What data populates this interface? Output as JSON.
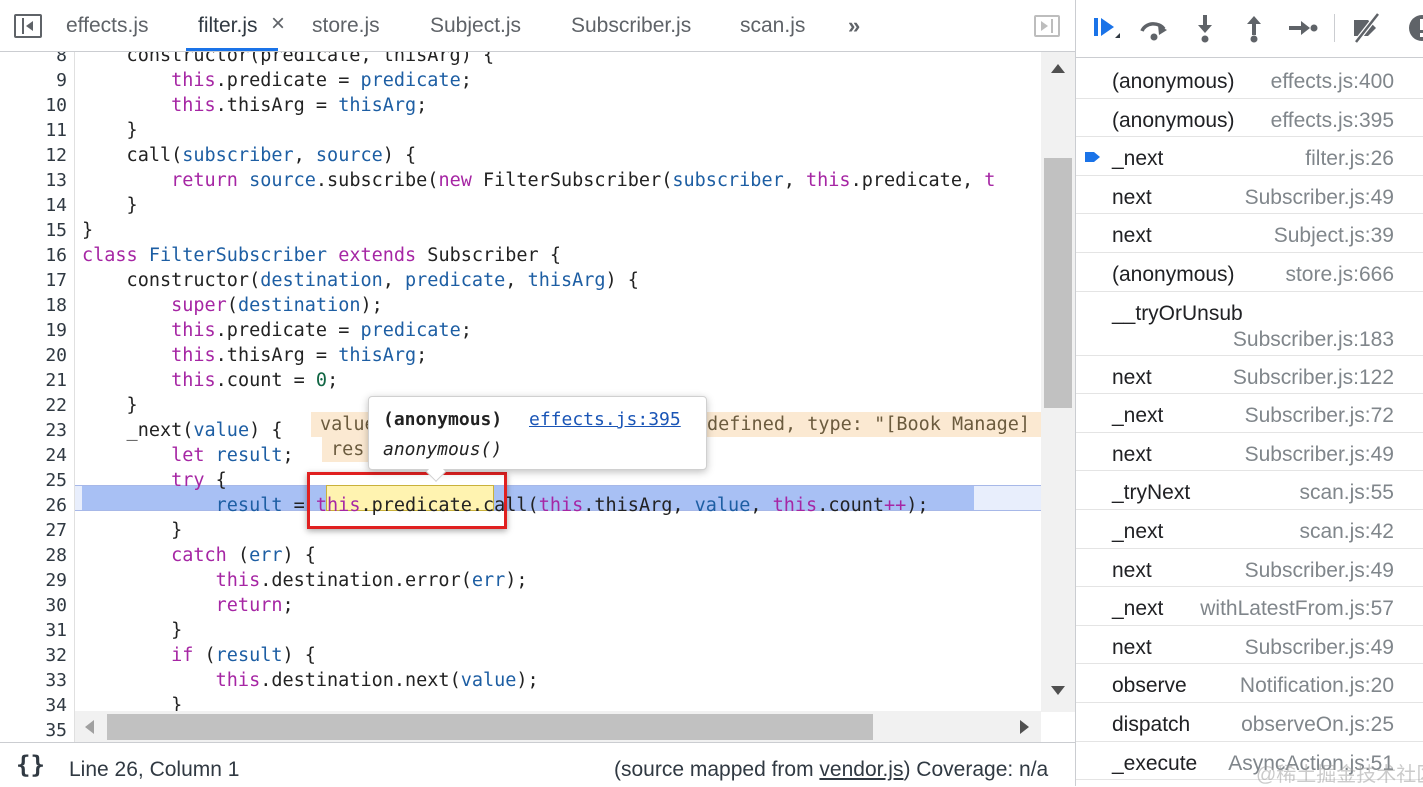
{
  "tabs": [
    {
      "label": "effects.js",
      "active": false
    },
    {
      "label": "filter.js",
      "active": true,
      "close": "×"
    },
    {
      "label": "store.js",
      "active": false
    },
    {
      "label": "Subject.js",
      "active": false
    },
    {
      "label": "Subscriber.js",
      "active": false
    },
    {
      "label": "scan.js",
      "active": false
    }
  ],
  "tab_more": "»",
  "editor": {
    "lines": [
      {
        "n": "8",
        "html": "    constructor(predicate, thisArg) {"
      },
      {
        "n": "9",
        "html": "        <span class=\"kw\">this</span>.predicate = <span class=\"prm\">predicate</span>;"
      },
      {
        "n": "10",
        "html": "        <span class=\"kw\">this</span>.thisArg = <span class=\"prm\">thisArg</span>;"
      },
      {
        "n": "11",
        "html": "    }"
      },
      {
        "n": "12",
        "html": "    call(<span class=\"prm\">subscriber</span>, <span class=\"prm\">source</span>) {"
      },
      {
        "n": "13",
        "html": "        <span class=\"kw\">return</span> <span class=\"prm\">source</span>.subscribe(<span class=\"kw\">new</span> FilterSubscriber(<span class=\"prm\">subscriber</span>, <span class=\"kw\">this</span>.predicate, <span class=\"kw\">t</span>"
      },
      {
        "n": "14",
        "html": "    }"
      },
      {
        "n": "15",
        "html": "}"
      },
      {
        "n": "16",
        "html": "<span class=\"kw\">class</span> <span class=\"prm\">FilterSubscriber</span> <span class=\"kw\">extends</span> Subscriber {"
      },
      {
        "n": "17",
        "html": "    constructor(<span class=\"prm\">destination</span>, <span class=\"prm\">predicate</span>, <span class=\"prm\">thisArg</span>) {"
      },
      {
        "n": "18",
        "html": "        <span class=\"kw\">super</span>(<span class=\"prm\">destination</span>);"
      },
      {
        "n": "19",
        "html": "        <span class=\"kw\">this</span>.predicate = <span class=\"prm\">predicate</span>;"
      },
      {
        "n": "20",
        "html": "        <span class=\"kw\">this</span>.thisArg = <span class=\"prm\">thisArg</span>;"
      },
      {
        "n": "21",
        "html": "        <span class=\"kw\">this</span>.count = <span class=\"num\">0</span>;"
      },
      {
        "n": "22",
        "html": "    }"
      },
      {
        "n": "23",
        "html": "    _next(<span class=\"prm\">value</span>) {"
      },
      {
        "n": "24",
        "html": "        <span class=\"kw\">let</span> <span class=\"prm\">result</span>;"
      },
      {
        "n": "25",
        "html": "        <span class=\"kw\">try</span> {"
      },
      {
        "n": "26",
        "html": "            <span class=\"prm\">result</span> = <span class=\"kw\">this</span>.predicate.call(<span class=\"kw\">this</span>.thisArg, <span class=\"prm\">value</span>, <span class=\"kw\">this</span>.count<span class=\"kw\">++</span>);"
      },
      {
        "n": "27",
        "html": "        }"
      },
      {
        "n": "28",
        "html": "        <span class=\"kw\">catch</span> (<span class=\"prm\">err</span>) {"
      },
      {
        "n": "29",
        "html": "            <span class=\"kw\">this</span>.destination.error(<span class=\"prm\">err</span>);"
      },
      {
        "n": "30",
        "html": "            <span class=\"kw\">return</span>;"
      },
      {
        "n": "31",
        "html": "        }"
      },
      {
        "n": "32",
        "html": "        <span class=\"kw\">if</span> (<span class=\"prm\">result</span>) {"
      },
      {
        "n": "33",
        "html": "            <span class=\"kw\">this</span>.destination.next(<span class=\"prm\">value</span>);"
      },
      {
        "n": "34",
        "html": "        }"
      },
      {
        "n": "35",
        "html": ""
      }
    ],
    "inline_value_line23": "value",
    "inline_value_line23_tail": "defined, type: \"[Book Manage]",
    "inline_value_line24": "res",
    "highlight_text": "this.predicate",
    "popover": {
      "name": "(anonymous)",
      "link": "effects.js:395",
      "signature": "anonymous()"
    }
  },
  "status": {
    "braces": "{}",
    "position": "Line 26, Column 1",
    "source_prefix": "(source mapped from ",
    "source_file": "vendor.js",
    "source_suffix": ")  Coverage: n/a"
  },
  "call_stack": [
    {
      "name": "(anonymous)",
      "loc": "effects.js:400"
    },
    {
      "name": "(anonymous)",
      "loc": "effects.js:395"
    },
    {
      "name": "_next",
      "loc": "filter.js:26",
      "current": true
    },
    {
      "name": "next",
      "loc": "Subscriber.js:49"
    },
    {
      "name": "next",
      "loc": "Subject.js:39"
    },
    {
      "name": "(anonymous)",
      "loc": "store.js:666"
    },
    {
      "name": "__tryOrUnsub",
      "loc": "Subscriber.js:183",
      "two_line": true
    },
    {
      "name": "next",
      "loc": "Subscriber.js:122"
    },
    {
      "name": "_next",
      "loc": "Subscriber.js:72"
    },
    {
      "name": "next",
      "loc": "Subscriber.js:49"
    },
    {
      "name": "_tryNext",
      "loc": "scan.js:55"
    },
    {
      "name": "_next",
      "loc": "scan.js:42"
    },
    {
      "name": "next",
      "loc": "Subscriber.js:49"
    },
    {
      "name": "_next",
      "loc": "withLatestFrom.js:57"
    },
    {
      "name": "next",
      "loc": "Subscriber.js:49"
    },
    {
      "name": "observe",
      "loc": "Notification.js:20"
    },
    {
      "name": "dispatch",
      "loc": "observeOn.js:25"
    },
    {
      "name": "_execute",
      "loc": "AsyncAction.js:51"
    }
  ],
  "watermark": "@稀土掘金技术社区",
  "colors": {
    "accent": "#1a73e8",
    "selection": "#a8c0f4",
    "redbox": "#e02020"
  }
}
